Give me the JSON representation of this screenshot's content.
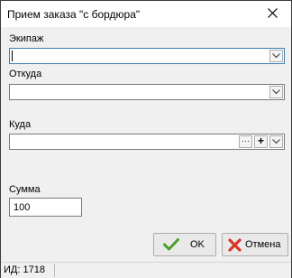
{
  "window": {
    "title": "Прием заказа \"с бордюра\""
  },
  "form": {
    "crew": {
      "label": "Экипаж",
      "value": ""
    },
    "from": {
      "label": "Откуда",
      "value": ""
    },
    "to": {
      "label": "Куда",
      "value": "",
      "more_button": "···",
      "add_button": "+"
    },
    "sum": {
      "label": "Сумма",
      "value": "100"
    }
  },
  "buttons": {
    "ok_label": "OK",
    "cancel_label": "Отмена"
  },
  "status": {
    "id_text": "ИД: 1718"
  },
  "colors": {
    "ok_check": "#4a9e2f",
    "cancel_x": "#d9362b",
    "focus_border": "#3c7fb1"
  }
}
